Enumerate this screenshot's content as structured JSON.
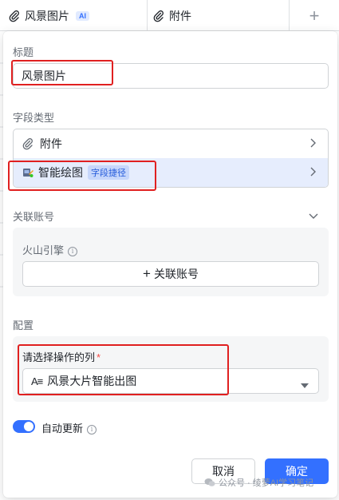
{
  "grid_header": {
    "col1_label": "风景图片",
    "col1_badge": "AI",
    "col2_label": "附件",
    "add_symbol": "+"
  },
  "panel": {
    "title_label": "标题",
    "title_value": "风景图片",
    "field_type_label": "字段类型",
    "field_types": [
      {
        "label": "附件",
        "icon": "paperclip-icon"
      },
      {
        "label": "智能绘图",
        "badge": "字段捷径",
        "icon": "ai-drawing-icon",
        "selected": true
      }
    ],
    "account_label": "关联账号",
    "engine_label": "火山引擎",
    "link_account_button": "关联账号",
    "config_label": "配置",
    "column_select_label": "请选择操作的列",
    "required_mark": "*",
    "column_select_value": "风景大片智能出图",
    "auto_update_label": "自动更新",
    "cancel_label": "取消",
    "confirm_label": "确定"
  },
  "watermark": {
    "text": "公众号 · 绫萝AI学习笔记"
  },
  "colors": {
    "accent": "#3370ff",
    "highlight_box": "#e02020",
    "selected_row_bg": "#e6edfd"
  }
}
